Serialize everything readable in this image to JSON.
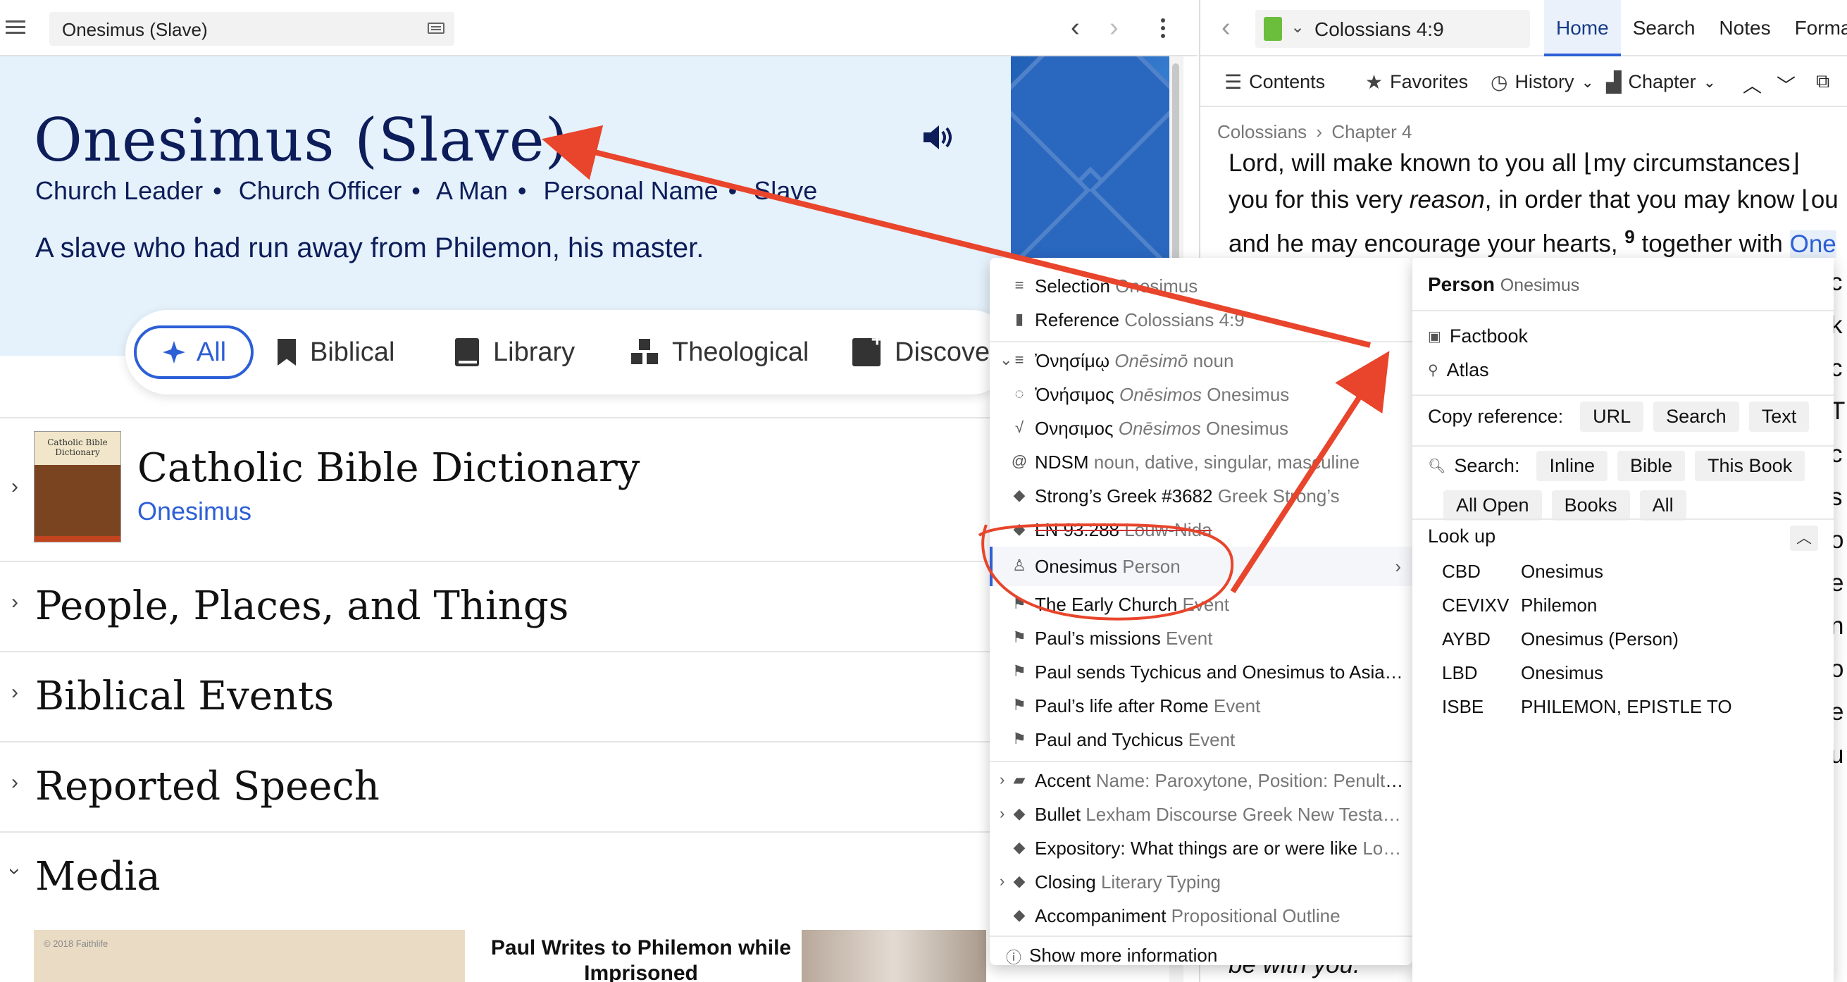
{
  "left": {
    "search_value": "Onesimus (Slave)",
    "hero": {
      "title": "Onesimus (Slave)",
      "tags": [
        "Church Leader",
        "Church Officer",
        "A Man",
        "Personal Name",
        "Slave"
      ],
      "description": "A slave who had run away from Philemon, his master."
    },
    "filters": [
      "All",
      "Biblical",
      "Library",
      "Theological",
      "Discove"
    ],
    "cbd": {
      "cover": "Catholic Bible Dictionary",
      "title": "Catholic Bible Dictionary",
      "link": "Onesimus"
    },
    "sections": [
      "People, Places, and Things",
      "Biblical Events",
      "Reported Speech",
      "Media"
    ],
    "media": {
      "map_copyright": "© 2018 Faithlife",
      "caption": "Paul Writes to Philemon while Imprisoned"
    }
  },
  "right": {
    "resource": "Colossians 4:9",
    "tabs": [
      "Home",
      "Search",
      "Notes",
      "Formatti"
    ],
    "tools": {
      "contents": "Contents",
      "favorites": "Favorites",
      "history": "History",
      "chapter": "Chapter"
    },
    "breadcrumb": [
      "Colossians",
      "Chapter 4"
    ],
    "text_lines": [
      "Lord, will make known to you all ⌊my circumstances⌋",
      "you for this very ",
      "and he may encourage your hearts, "
    ],
    "text_reason": "reason",
    "text_tail": ", in order that you may know ⌊ou",
    "verse": "9",
    "text_together": " together with ",
    "text_highlight": "One",
    "side_letters": [
      "c",
      "k",
      "c",
      "T",
      "c",
      "s",
      "o",
      "e",
      "n",
      "o",
      "e",
      "u"
    ],
    "bottom_text": "be with you."
  },
  "context_menu": {
    "items": [
      {
        "label": "Selection",
        "sub": "Onesimus"
      },
      {
        "label": "Reference",
        "sub": "Colossians 4:9"
      },
      {
        "label": "Ὀνησίμῳ",
        "sub": "Onēsimō",
        "sub2": "noun"
      },
      {
        "label": "Ὀνήσιμος",
        "sub": "Onēsimos",
        "sub2": "Onesimus"
      },
      {
        "label": "Ονησιμος",
        "sub": "Onēsimos",
        "sub2": "Onesimus"
      },
      {
        "label": "NDSM",
        "sub": "noun, dative, singular, masculine"
      },
      {
        "label": "Strong’s Greek #3682",
        "sub": "Greek Strong’s"
      },
      {
        "label": "LN 93.288",
        "sub": "Louw-Nida"
      },
      {
        "label": "Onesimus",
        "sub": "Person"
      },
      {
        "label": "The Early Church",
        "sub": "Event"
      },
      {
        "label": "Paul’s missions",
        "sub": "Event"
      },
      {
        "label": "Paul sends Tychicus and Onesimus to Asia…",
        "sub": ""
      },
      {
        "label": "Paul’s life after Rome",
        "sub": "Event"
      },
      {
        "label": "Paul and Tychicus",
        "sub": "Event"
      },
      {
        "label": "Accent",
        "sub": "Name: Paroxytone, Position: Penult,…"
      },
      {
        "label": "Bullet",
        "sub": "Lexham Discourse Greek New Testa…"
      },
      {
        "label": "Expository: What things are or were like",
        "sub": "Lo…"
      },
      {
        "label": "Closing",
        "sub": "Literary Typing"
      },
      {
        "label": "Accompaniment",
        "sub": "Propositional Outline"
      }
    ],
    "footer": "Show more information"
  },
  "submenu": {
    "head": "Person",
    "head_sub": "Onesimus",
    "factbook": "Factbook",
    "atlas": "Atlas",
    "copy_label": "Copy reference:",
    "copy_buttons": [
      "URL",
      "Search",
      "Text"
    ],
    "search_label": "Search:",
    "search_buttons": [
      "Inline",
      "Bible",
      "This Book",
      "All Open",
      "Books",
      "All"
    ],
    "lookup_label": "Look up",
    "lookup": [
      {
        "abbr": "CBD",
        "value": "Onesimus"
      },
      {
        "abbr": "CEVIXV",
        "value": "Philemon"
      },
      {
        "abbr": "AYBD",
        "value": "Onesimus (Person)"
      },
      {
        "abbr": "LBD",
        "value": "Onesimus"
      },
      {
        "abbr": "ISBE",
        "value": "PHILEMON, EPISTLE TO"
      }
    ]
  },
  "colors": {
    "accent": "#2d5fd6",
    "hero_bg": "#e5f1fb",
    "annotation": "#e8452c",
    "title": "#0d1d5a"
  }
}
